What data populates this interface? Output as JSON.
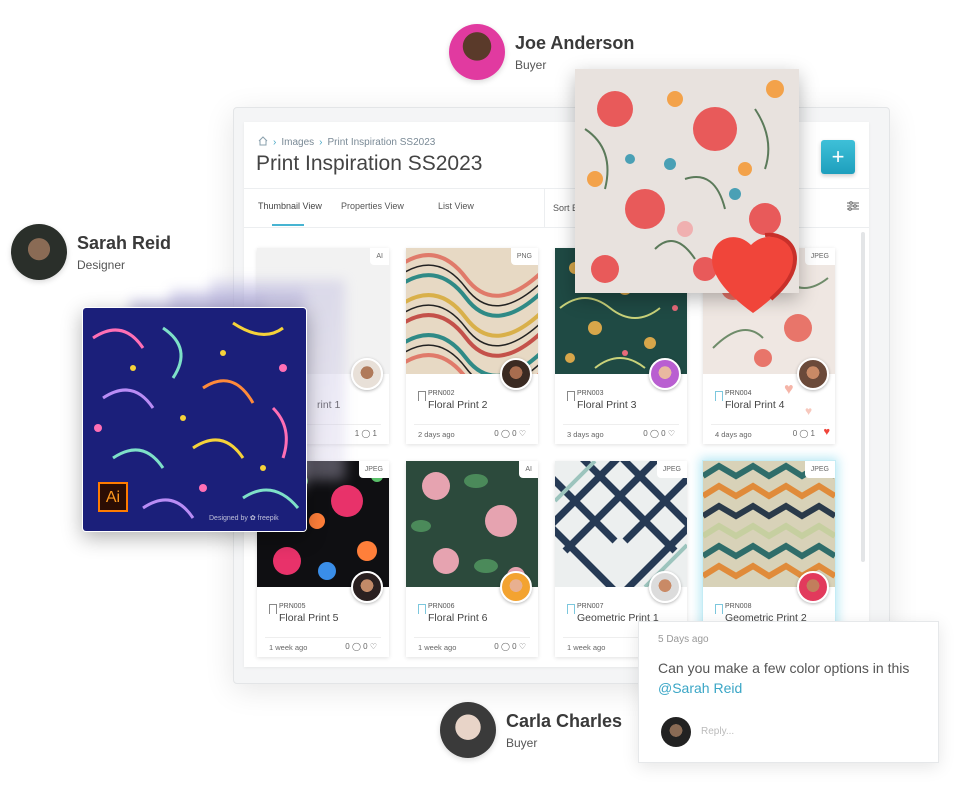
{
  "people": {
    "joe": {
      "name": "Joe Anderson",
      "role": "Buyer"
    },
    "sarah": {
      "name": "Sarah Reid",
      "role": "Designer"
    },
    "carla": {
      "name": "Carla Charles",
      "role": "Buyer"
    }
  },
  "app": {
    "breadcrumb": {
      "root": "Images",
      "current": "Print Inspiration SS2023"
    },
    "title": "Print Inspiration SS2023",
    "add_label": "+",
    "tabs": [
      "Thumbnail View",
      "Properties View",
      "List View"
    ],
    "sort_label": "Sort By",
    "cards": [
      {
        "type": "AI",
        "code": "",
        "title": "rint 1",
        "age": "",
        "stats": "1 ◯ 1"
      },
      {
        "type": "PNG",
        "code": "PRN002",
        "title": "Floral Print 2",
        "age": "2 days ago",
        "stats": "0 ◯ 0 ♡"
      },
      {
        "type": "",
        "code": "PRN003",
        "title": "Floral Print 3",
        "age": "3 days ago",
        "stats": "0 ◯ 0 ♡"
      },
      {
        "type": "JPEG",
        "code": "PRN004",
        "title": "Floral Print 4",
        "age": "4 days ago",
        "stats": "0 ◯ 1"
      },
      {
        "type": "JPEG",
        "code": "PRN005",
        "title": "Floral Print 5",
        "age": "1 week ago",
        "stats": "0 ◯ 0 ♡"
      },
      {
        "type": "AI",
        "code": "PRN006",
        "title": "Floral Print 6",
        "age": "1 week ago",
        "stats": "0 ◯ 0 ♡"
      },
      {
        "type": "JPEG",
        "code": "PRN007",
        "title": "Geometric Print 1",
        "age": "1 week ago",
        "stats": ""
      },
      {
        "type": "JPEG",
        "code": "PRN008",
        "title": "Geometric Print 2",
        "age": "",
        "stats": ""
      }
    ]
  },
  "floating": {
    "ai_badge": "Ai",
    "credit": "Designed by ✿ freepik"
  },
  "comment": {
    "when": "5 Days ago",
    "message": "Can you make a few color options in this",
    "mention": "@Sarah Reid",
    "reply_placeholder": "Reply..."
  },
  "colors": {
    "accent": "#3aa6c6",
    "add_button": "#22a6c4",
    "heart": "#f0453a"
  }
}
